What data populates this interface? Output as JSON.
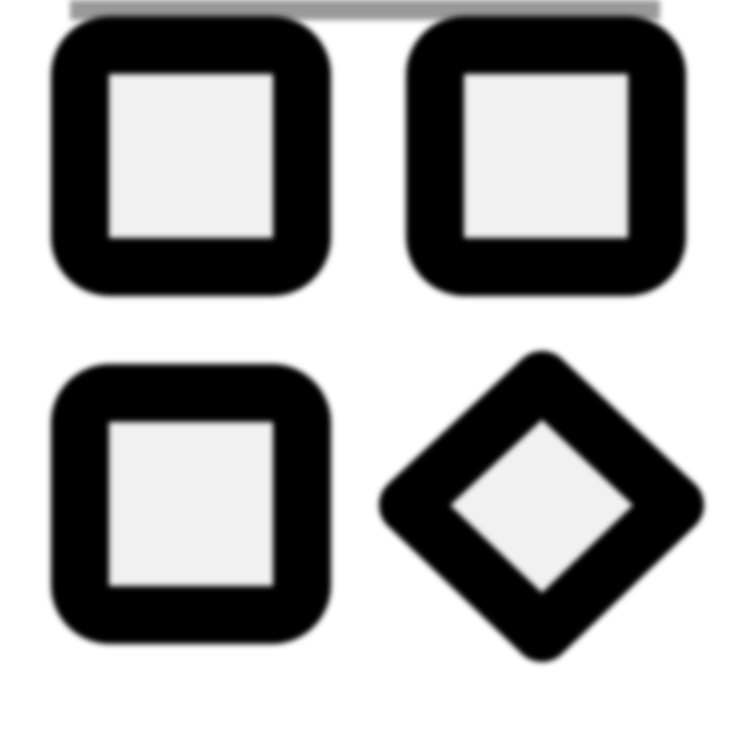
{
  "icon": {
    "name": "apps-grid-icon",
    "stroke_color": "#000000",
    "fill_color": "#f1f1f1",
    "tile_count": 4,
    "tiles": [
      {
        "name": "square",
        "shape": "square"
      },
      {
        "name": "square",
        "shape": "square"
      },
      {
        "name": "square",
        "shape": "square"
      },
      {
        "name": "diamond",
        "shape": "diamond"
      }
    ]
  }
}
